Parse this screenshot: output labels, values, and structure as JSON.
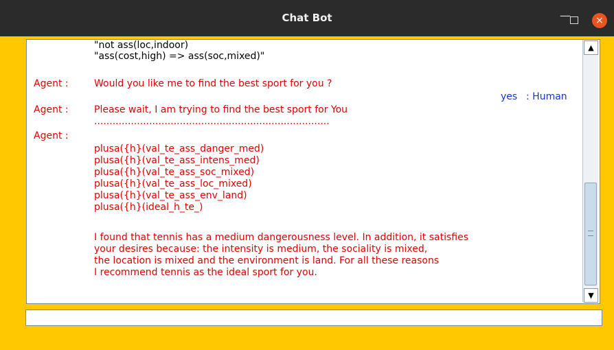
{
  "window": {
    "title": "Chat Bot",
    "buttons": {
      "minimize": "—",
      "close": "×"
    }
  },
  "chat": {
    "lines": [
      {
        "speaker": "",
        "text": "\"not ass(loc,indoor)"
      },
      {
        "speaker": "",
        "text": "\"ass(cost,high) => ass(soc,mixed)\""
      },
      {
        "speaker": "Agent :",
        "text": "Would you like me to find the best sport for you ?"
      },
      {
        "speaker": "Human",
        "text": "yes"
      },
      {
        "speaker": "Agent :",
        "text": "Please wait, I am trying to find the best sport for You"
      },
      {
        "speaker": "",
        "text": "............................................................................."
      },
      {
        "speaker": "Agent :",
        "text": "plusa({h}(val_te_ass_danger_med)"
      },
      {
        "speaker": "",
        "text": "plusa({h}(val_te_ass_intens_med)"
      },
      {
        "speaker": "",
        "text": "plusa({h}(val_te_ass_soc_mixed)"
      },
      {
        "speaker": "",
        "text": "plusa({h}(val_te_ass_loc_mixed)"
      },
      {
        "speaker": "",
        "text": "plusa({h}(val_te_ass_env_land)"
      },
      {
        "speaker": "",
        "text": "plusa({h}(ideal_h_te_)"
      },
      {
        "speaker": "",
        "text": "I found that tennis has a medium dangerousness level. In addition, it satisfies"
      },
      {
        "speaker": "",
        "text": "your desires because: the intensity is medium, the sociality is mixed,"
      },
      {
        "speaker": "",
        "text": "the location is mixed and the environment is land. For all these reasons"
      },
      {
        "speaker": "",
        "text": "I recommend tennis as the ideal sport for you."
      }
    ],
    "human_reply_label": ": Human"
  },
  "input": {
    "value": "",
    "placeholder": ""
  },
  "colors": {
    "window_bg": "#ffc800",
    "agent_text": "#e00000",
    "human_text": "#1533d3",
    "titlebar": "#2b2b2b",
    "close_button": "#e95420"
  }
}
